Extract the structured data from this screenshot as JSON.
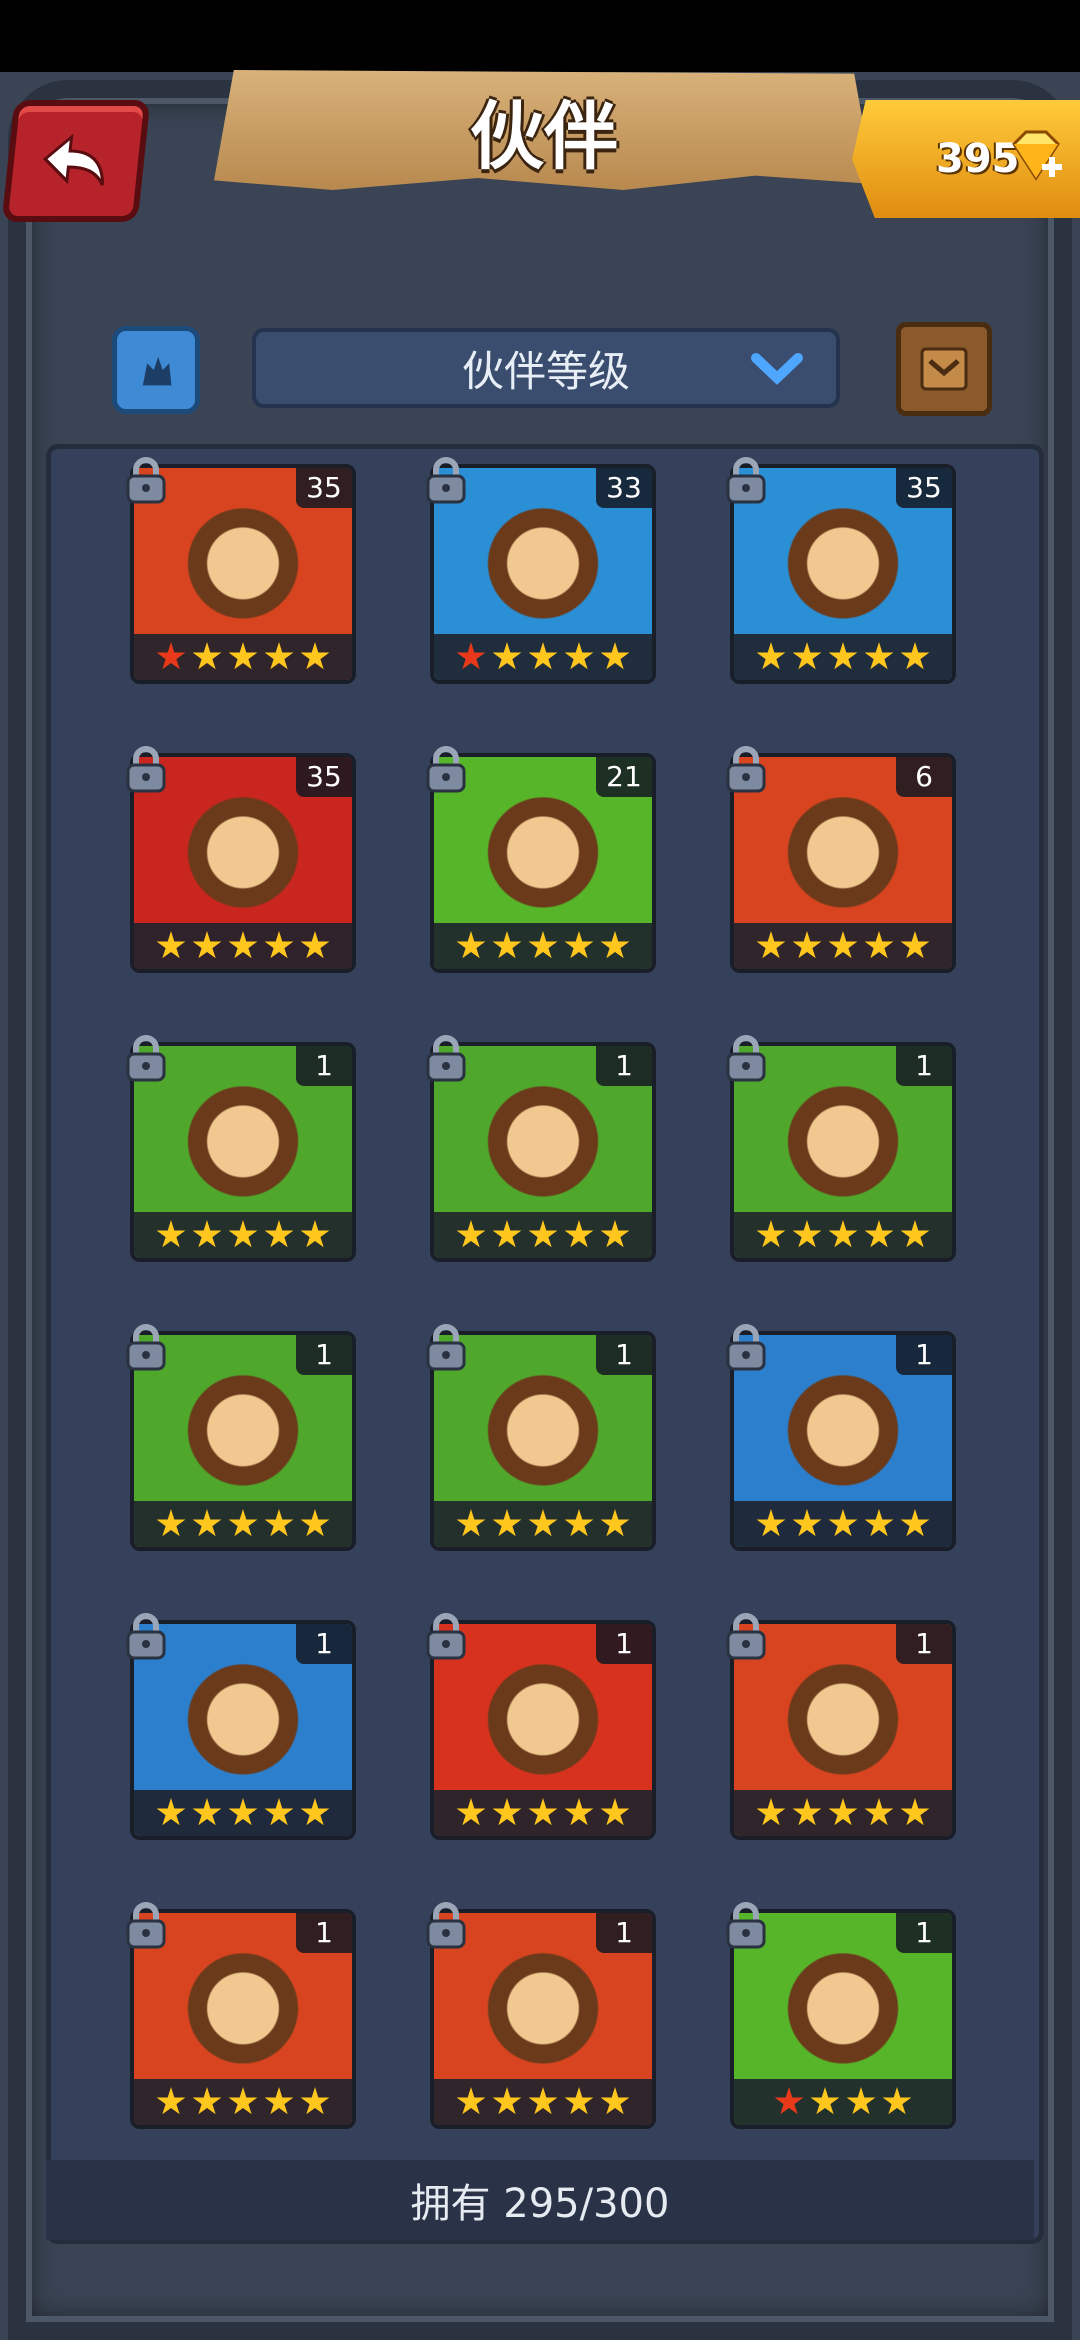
{
  "header": {
    "title": "伙伴",
    "gems": "395"
  },
  "toolbar": {
    "sort_label": "伙伴等级"
  },
  "heroes": [
    {
      "level": "35",
      "bg": "#d7441f",
      "stars": 5,
      "red_stars": 1
    },
    {
      "level": "33",
      "bg": "#2b8fd6",
      "stars": 5,
      "red_stars": 1
    },
    {
      "level": "35",
      "bg": "#2b8fd6",
      "stars": 5,
      "red_stars": 0
    },
    {
      "level": "35",
      "bg": "#c8261e",
      "stars": 5,
      "red_stars": 0
    },
    {
      "level": "21",
      "bg": "#57b52a",
      "stars": 5,
      "red_stars": 0
    },
    {
      "level": "6",
      "bg": "#d7441f",
      "stars": 5,
      "red_stars": 0
    },
    {
      "level": "1",
      "bg": "#4fa82c",
      "stars": 5,
      "red_stars": 0
    },
    {
      "level": "1",
      "bg": "#4fa82c",
      "stars": 5,
      "red_stars": 0
    },
    {
      "level": "1",
      "bg": "#4fa82c",
      "stars": 5,
      "red_stars": 0
    },
    {
      "level": "1",
      "bg": "#4fa82c",
      "stars": 5,
      "red_stars": 0
    },
    {
      "level": "1",
      "bg": "#4fa82c",
      "stars": 5,
      "red_stars": 0
    },
    {
      "level": "1",
      "bg": "#2b7fcc",
      "stars": 5,
      "red_stars": 0
    },
    {
      "level": "1",
      "bg": "#2b7fcc",
      "stars": 5,
      "red_stars": 0
    },
    {
      "level": "1",
      "bg": "#d7321e",
      "stars": 5,
      "red_stars": 0
    },
    {
      "level": "1",
      "bg": "#d7441f",
      "stars": 5,
      "red_stars": 0
    },
    {
      "level": "1",
      "bg": "#d7441f",
      "stars": 5,
      "red_stars": 0
    },
    {
      "level": "1",
      "bg": "#d7441f",
      "stars": 5,
      "red_stars": 0
    },
    {
      "level": "1",
      "bg": "#57b52a",
      "stars": 4,
      "red_stars": 1
    }
  ],
  "footer": {
    "owned_text": "拥有 295/300"
  }
}
